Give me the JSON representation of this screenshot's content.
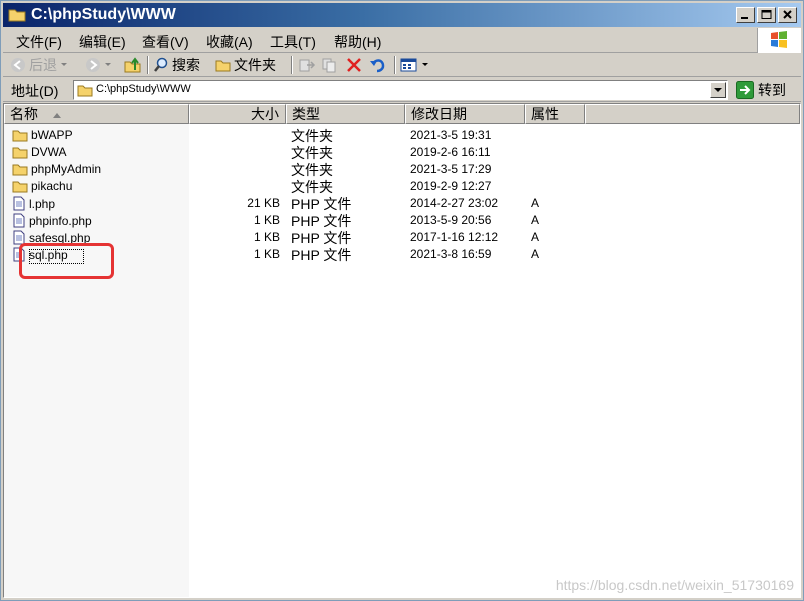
{
  "window": {
    "title": "C:\\phpStudy\\WWW"
  },
  "menu": [
    {
      "label": "文件(F)"
    },
    {
      "label": "编辑(E)"
    },
    {
      "label": "查看(V)"
    },
    {
      "label": "收藏(A)"
    },
    {
      "label": "工具(T)"
    },
    {
      "label": "帮助(H)"
    }
  ],
  "toolbar": {
    "back_label": "后退",
    "search_label": "搜索",
    "folders_label": "文件夹"
  },
  "address": {
    "label": "地址(D)",
    "path": "C:\\phpStudy\\WWW",
    "go_label": "转到"
  },
  "columns": {
    "name": "名称",
    "size": "大小",
    "type": "类型",
    "modified": "修改日期",
    "attributes": "属性"
  },
  "files": [
    {
      "name": "bWAPP",
      "size": "",
      "type": "文件夹",
      "modified": "2021-3-5 19:31",
      "attr": "",
      "icon": "folder-icon"
    },
    {
      "name": "DVWA",
      "size": "",
      "type": "文件夹",
      "modified": "2019-2-6 16:11",
      "attr": "",
      "icon": "folder-icon"
    },
    {
      "name": "phpMyAdmin",
      "size": "",
      "type": "文件夹",
      "modified": "2021-3-5 17:29",
      "attr": "",
      "icon": "folder-icon"
    },
    {
      "name": "pikachu",
      "size": "",
      "type": "文件夹",
      "modified": "2019-2-9 12:27",
      "attr": "",
      "icon": "folder-icon"
    },
    {
      "name": "l.php",
      "size": "21 KB",
      "type": "PHP 文件",
      "modified": "2014-2-27 23:02",
      "attr": "A",
      "icon": "file-icon"
    },
    {
      "name": "phpinfo.php",
      "size": "1 KB",
      "type": "PHP 文件",
      "modified": "2013-5-9 20:56",
      "attr": "A",
      "icon": "file-icon"
    },
    {
      "name": "safesql.php",
      "size": "1 KB",
      "type": "PHP 文件",
      "modified": "2017-1-16 12:12",
      "attr": "A",
      "icon": "file-icon"
    },
    {
      "name": "sql.php",
      "size": "1 KB",
      "type": "PHP 文件",
      "modified": "2021-3-8 16:59",
      "attr": "A",
      "icon": "file-icon"
    }
  ],
  "watermark": "https://blog.csdn.net/weixin_51730169",
  "colors": {
    "title_start": "#0a246a",
    "highlight": "#e53333",
    "folder": "#f5d26b"
  }
}
